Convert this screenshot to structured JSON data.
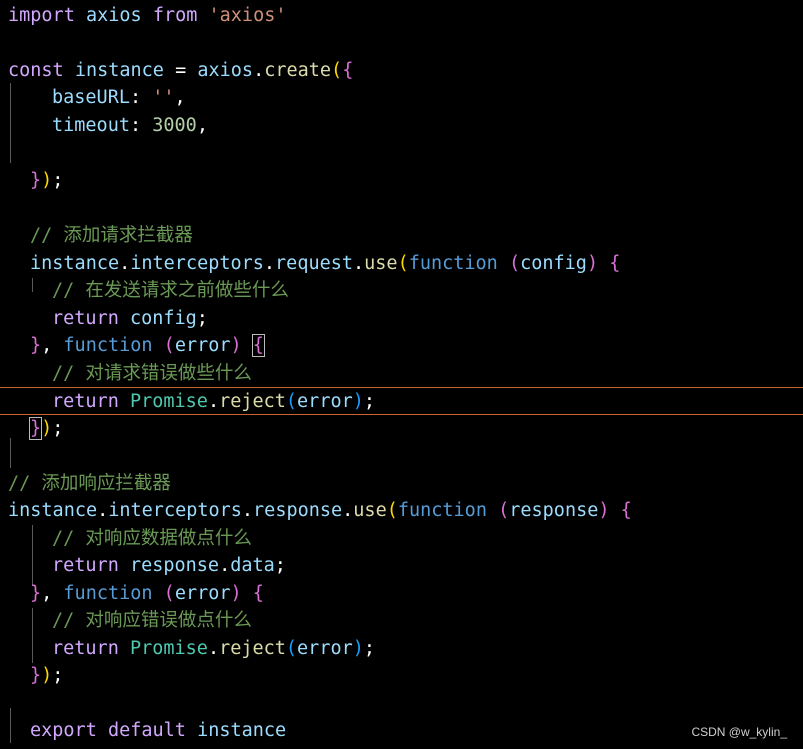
{
  "watermark": "CSDN @w_kylin_",
  "code": {
    "l1": {
      "t0": "import",
      "t1": "axios",
      "t2": "from",
      "t3": "'axios'"
    },
    "l3": {
      "t0": "const",
      "t1": "instance",
      "t2": "=",
      "t3": "axios",
      "t4": ".",
      "t5": "create",
      "t6": "(",
      "t7": "{"
    },
    "l4": {
      "t0": "baseURL",
      "t1": ":",
      "t2": "''",
      "t3": ","
    },
    "l5": {
      "t0": "timeout",
      "t1": ":",
      "t2": "3000",
      "t3": ","
    },
    "l7": {
      "t0": "}",
      "t1": ")",
      "t2": ";"
    },
    "l9": {
      "t0": "// 添加请求拦截器"
    },
    "l10": {
      "t0": "instance",
      "t1": ".",
      "t2": "interceptors",
      "t3": ".",
      "t4": "request",
      "t5": ".",
      "t6": "use",
      "t7": "(",
      "t8": "function",
      "t9": "(",
      "t10": "config",
      "t11": ")",
      "t12": "{"
    },
    "l11": {
      "t0": "// 在发送请求之前做些什么"
    },
    "l12": {
      "t0": "return",
      "t1": "config",
      "t2": ";"
    },
    "l13": {
      "t0": "}",
      "t1": ",",
      "t2": "function",
      "t3": "(",
      "t4": "error",
      "t5": ")",
      "t6": "{"
    },
    "l14": {
      "t0": "// 对请求错误做些什么"
    },
    "l15": {
      "t0": "return",
      "t1": "Promise",
      "t2": ".",
      "t3": "reject",
      "t4": "(",
      "t5": "error",
      "t6": ")",
      "t7": ";"
    },
    "l16": {
      "t0": "}",
      "t1": ")",
      "t2": ";"
    },
    "l18": {
      "t0": "// 添加响应拦截器"
    },
    "l19": {
      "t0": "instance",
      "t1": ".",
      "t2": "interceptors",
      "t3": ".",
      "t4": "response",
      "t5": ".",
      "t6": "use",
      "t7": "(",
      "t8": "function",
      "t9": "(",
      "t10": "response",
      "t11": ")",
      "t12": "{"
    },
    "l20": {
      "t0": "// 对响应数据做点什么"
    },
    "l21": {
      "t0": "return",
      "t1": "response",
      "t2": ".",
      "t3": "data",
      "t4": ";"
    },
    "l22": {
      "t0": "}",
      "t1": ",",
      "t2": "function",
      "t3": "(",
      "t4": "error",
      "t5": ")",
      "t6": "{"
    },
    "l23": {
      "t0": "// 对响应错误做点什么"
    },
    "l24": {
      "t0": "return",
      "t1": "Promise",
      "t2": ".",
      "t3": "reject",
      "t4": "(",
      "t5": "error",
      "t6": ")",
      "t7": ";"
    },
    "l25": {
      "t0": "}",
      "t1": ")",
      "t2": ";"
    },
    "l27": {
      "t0": "export",
      "t1": "default",
      "t2": "instance"
    }
  }
}
